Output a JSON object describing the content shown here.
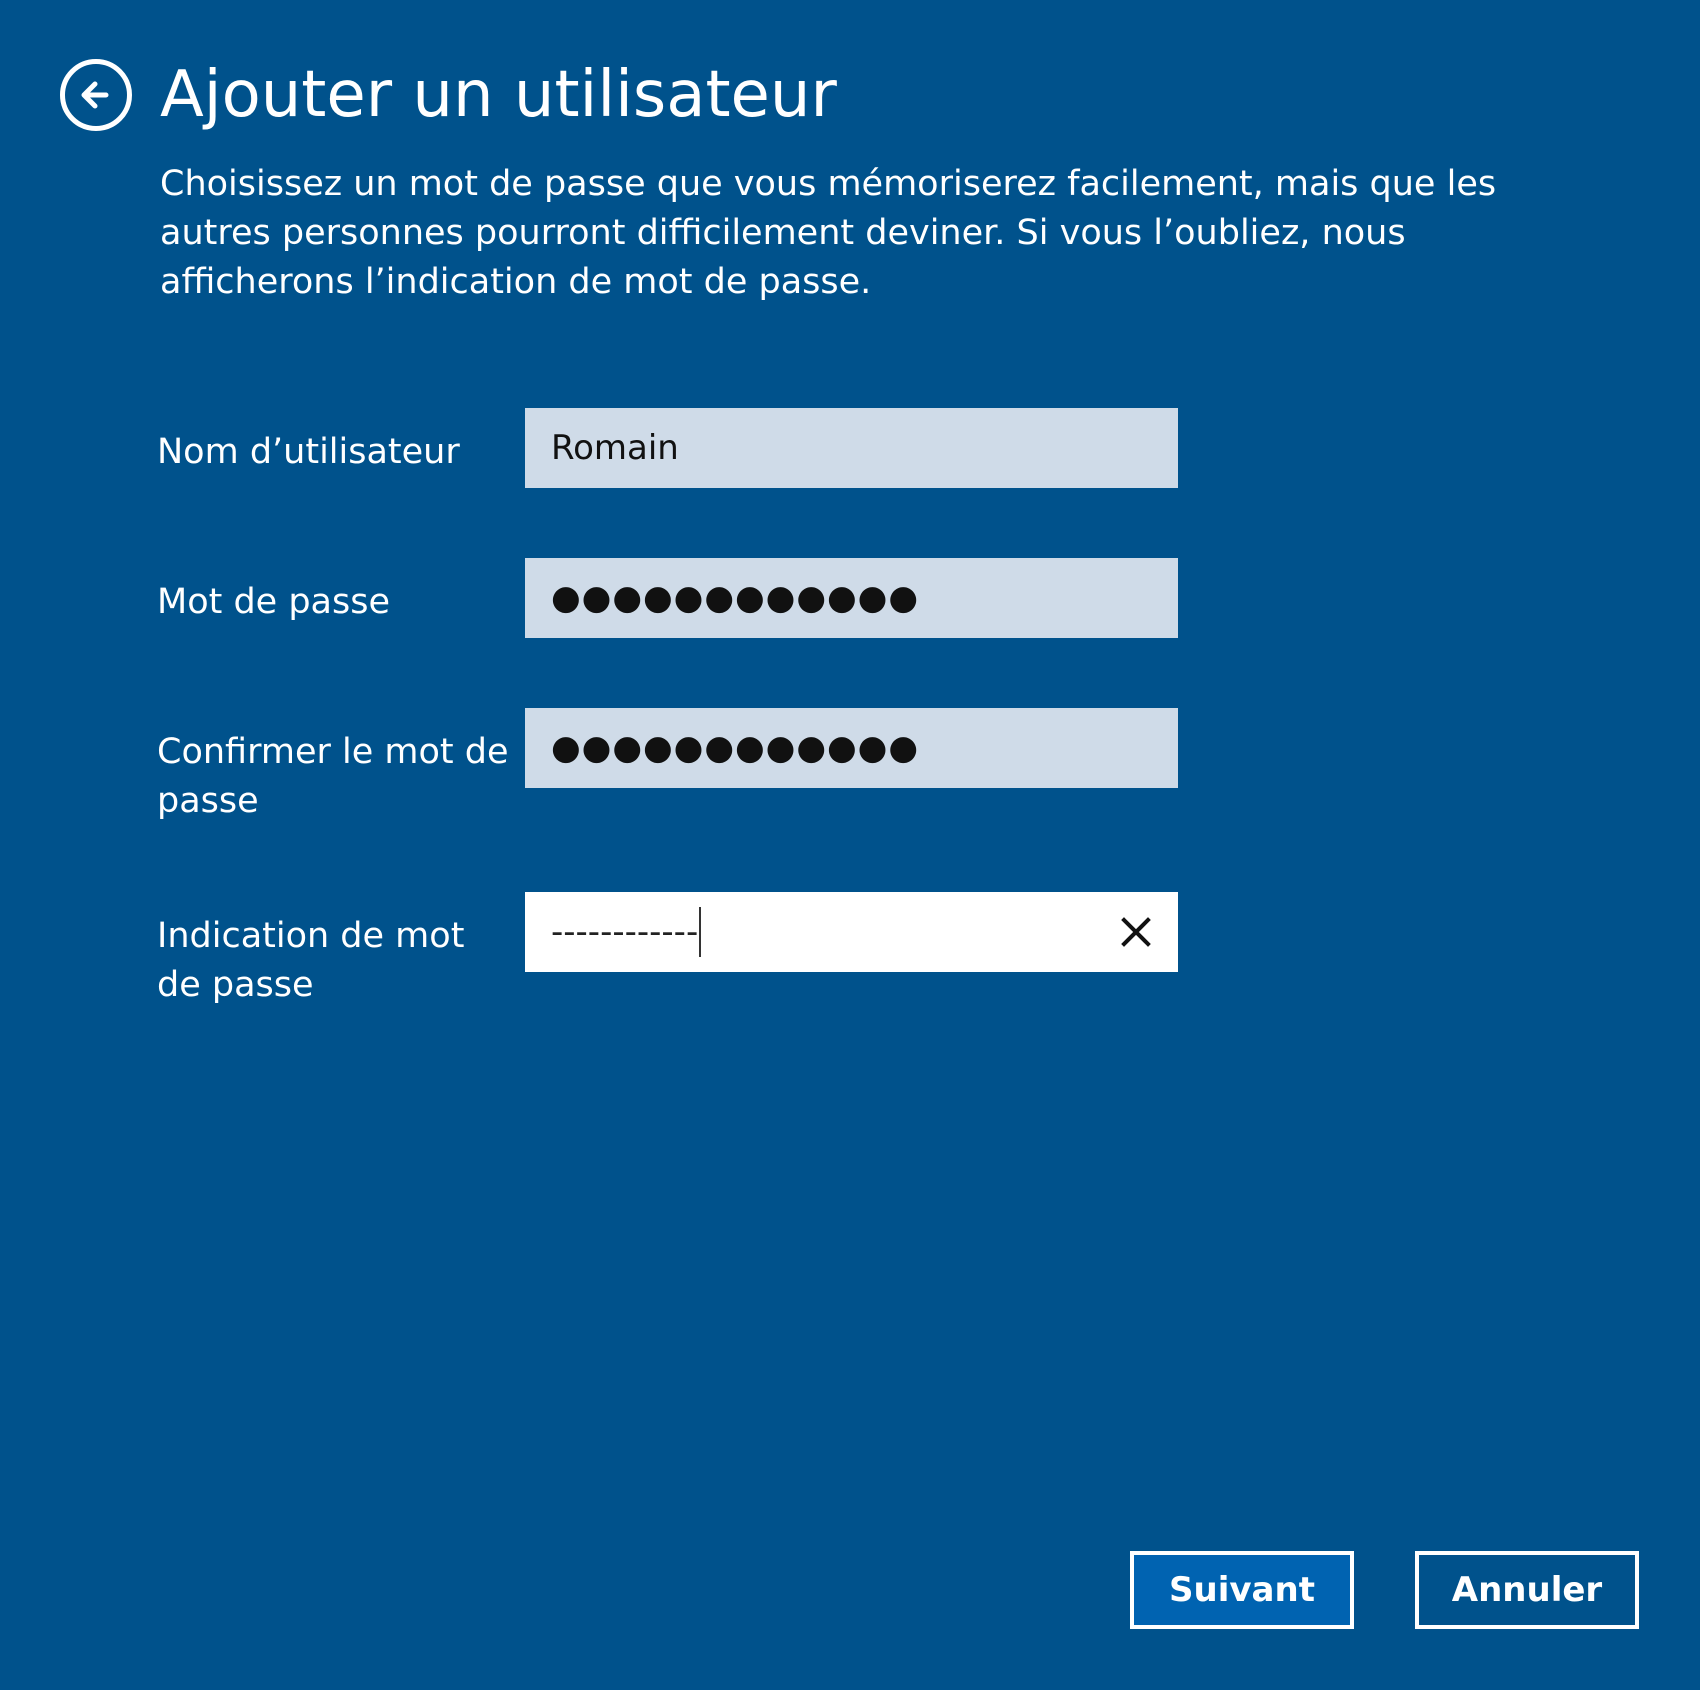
{
  "header": {
    "title": "Ajouter un utilisateur",
    "back_icon": "back-arrow-icon"
  },
  "description": "Choisissez un mot de passe que vous mémoriserez facilement, mais que les autres personnes pourront difficilement deviner. Si vous l’oubliez, nous afficherons l’indication de mot de passe.",
  "form": {
    "username": {
      "label": "Nom d’utilisateur",
      "value": "Romain"
    },
    "password": {
      "label": "Mot de passe",
      "masked_value": "●●●●●●●●●●●●"
    },
    "confirm_password": {
      "label": "Confirmer le mot de passe",
      "masked_value": "●●●●●●●●●●●●"
    },
    "password_hint": {
      "label": "Indication de mot de passe",
      "value": "------------",
      "clear_icon": "close-icon"
    }
  },
  "actions": {
    "next_label": "Suivant",
    "cancel_label": "Annuler"
  },
  "colors": {
    "background": "#00528c",
    "input_background": "#cfdbe8",
    "active_input_background": "#ffffff",
    "primary_button": "#0063b1",
    "text": "#ffffff"
  }
}
